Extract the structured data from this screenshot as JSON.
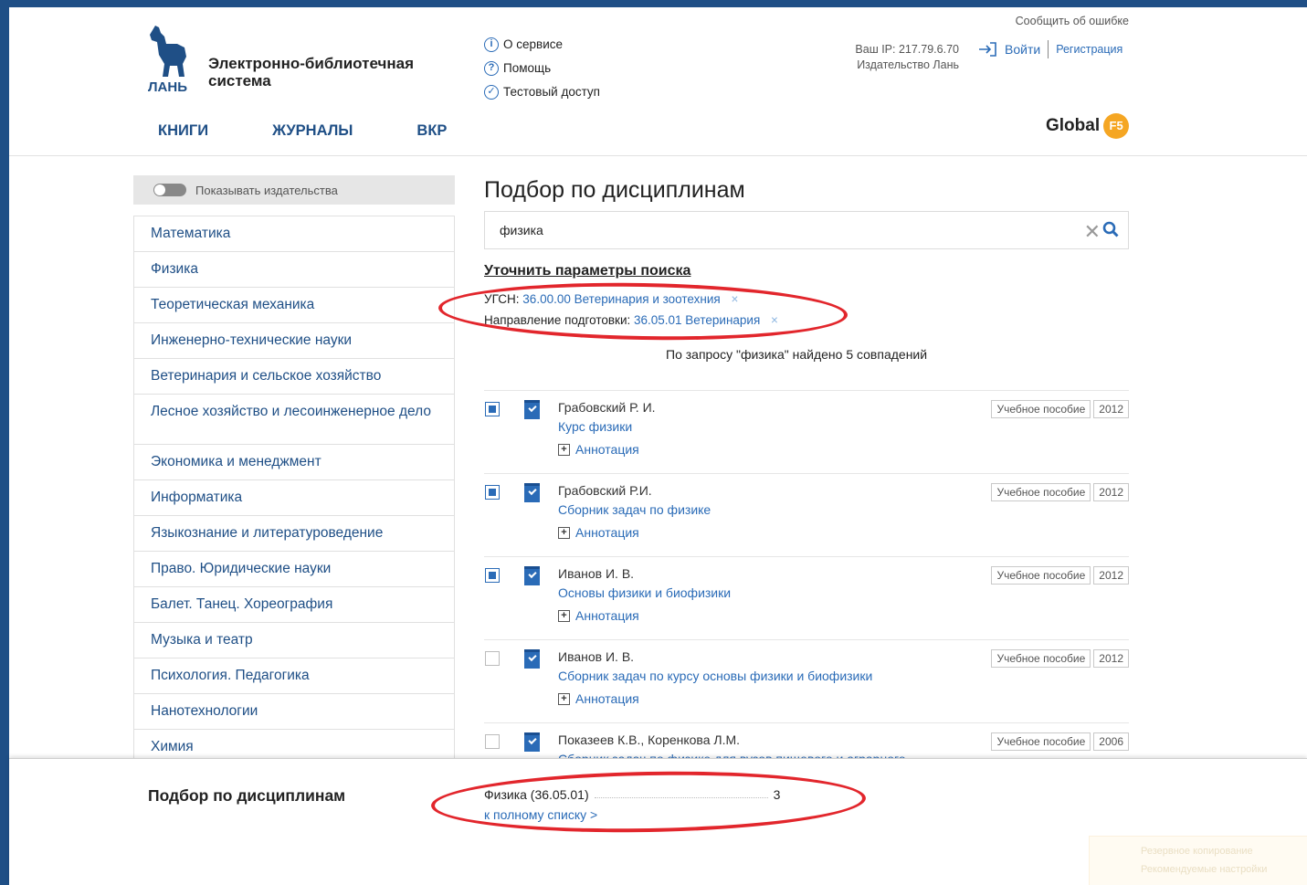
{
  "header": {
    "logo_text": "ЛАНЬ",
    "brand_line1": "Электронно-библиотечная",
    "brand_line2": "система",
    "top_links": [
      {
        "icon": "info-icon",
        "glyph": "i",
        "label": "О сервисе"
      },
      {
        "icon": "help-icon",
        "glyph": "?",
        "label": "Помощь"
      },
      {
        "icon": "check-circle-icon",
        "glyph": "✓",
        "label": "Тестовый доступ"
      }
    ],
    "report_error": "Сообщить об ошибке",
    "ip_label": "Ваш IP: 217.79.6.70",
    "publisher": "Издательство Лань",
    "login": "Войти",
    "register": "Регистрация",
    "nav": [
      "КНИГИ",
      "ЖУРНАЛЫ",
      "ВКР"
    ],
    "global_label": "Global",
    "global_badge": "F5"
  },
  "sidebar": {
    "toggle_label": "Показывать издательства",
    "subjects": [
      "Математика",
      "Физика",
      "Теоретическая механика",
      "Инженерно-технические науки",
      "Ветеринария и сельское хозяйство",
      "Лесное хозяйство и лесоинженерное дело",
      "Экономика и менеджмент",
      "Информатика",
      "Языкознание и литературоведение",
      "Право. Юридические науки",
      "Балет. Танец. Хореография",
      "Музыка и театр",
      "Психология. Педагогика",
      "Нанотехнологии",
      "Химия"
    ]
  },
  "main": {
    "title": "Подбор по дисциплинам",
    "search_value": "физика",
    "refine_title": "Уточнить параметры поиска",
    "filters": [
      {
        "key": "УГСН:",
        "value": "36.00.00 Ветеринария и зоотехния",
        "remove": "×"
      },
      {
        "key": "Направление подготовки:",
        "value": "36.05.01 Ветеринария",
        "remove": "×"
      }
    ],
    "found_text": "По запросу \"физика\" найдено 5 совпадений",
    "annotation_label": "Аннотация",
    "results": [
      {
        "checked": true,
        "author": "Грабовский Р. И.",
        "title": "Курс физики",
        "type": "Учебное пособие",
        "year": "2012"
      },
      {
        "checked": true,
        "author": "Грабовский Р.И.",
        "title": "Сборник задач по физике",
        "type": "Учебное пособие",
        "year": "2012"
      },
      {
        "checked": true,
        "author": "Иванов И. В.",
        "title": "Основы физики и биофизики",
        "type": "Учебное пособие",
        "year": "2012"
      },
      {
        "checked": false,
        "author": "Иванов И. В.",
        "title": "Сборник задач по курсу основы физики и биофизики",
        "type": "Учебное пособие",
        "year": "2012"
      },
      {
        "checked": false,
        "author": "Показеев К.В., Коренкова Л.М.",
        "title": "Сборник задач по физике для вузов пищевого и аграрного",
        "type": "Учебное пособие",
        "year": "2006"
      }
    ]
  },
  "bottom": {
    "title": "Подбор по дисциплинам",
    "item_label": "Физика (36.05.01)",
    "item_count": "3",
    "full_list_link": "к полному списку >",
    "faded_line1": "Резервное копирование",
    "faded_line2": "Рекомендуемые настройки"
  },
  "colors": {
    "brand_blue": "#1f4f86",
    "link_blue": "#2a6bb7",
    "annotation_red": "#e2262c",
    "badge_orange": "#f5a623"
  }
}
